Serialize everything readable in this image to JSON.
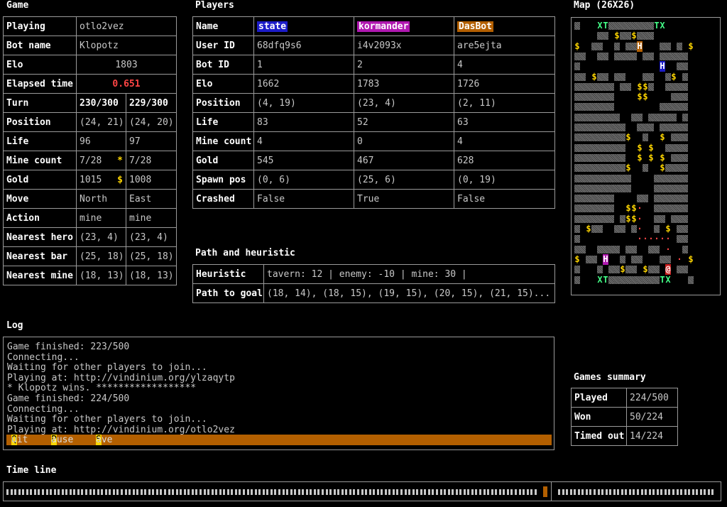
{
  "sections": {
    "game": "Game",
    "players": "Players",
    "map": "Map (26X26)",
    "path": "Path and heuristic",
    "log": "Log",
    "summary": "Games summary",
    "timeline": "Time line"
  },
  "game": {
    "playing_label": "Playing",
    "playing_value": "otlo2vez",
    "botname_label": "Bot name",
    "botname_value": "Klopotz",
    "elo_label": "Elo",
    "elo_value": "1803",
    "elapsed_label": "Elapsed time",
    "elapsed_value": "0.651",
    "turn_label": "Turn",
    "turn_a": "230/300",
    "turn_b": "229/300",
    "position_label": "Position",
    "position_a": "(24, 21)",
    "position_b": "(24, 20)",
    "life_label": "Life",
    "life_a": "96",
    "life_b": "97",
    "mine_label": "Mine count",
    "mine_a": "7/28",
    "mine_star": "*",
    "mine_b": "7/28",
    "gold_label": "Gold",
    "gold_a": "1015",
    "gold_sym": "$",
    "gold_b": "1008",
    "move_label": "Move",
    "move_a": "North",
    "move_b": "East",
    "action_label": "Action",
    "action_a": "mine",
    "action_b": "mine",
    "hero_label": "Nearest hero",
    "hero_a": "(23, 4)",
    "hero_b": "(23, 4)",
    "bar_label": "Nearest bar",
    "bar_a": "(25, 18)",
    "bar_b": "(25, 18)",
    "nmine_label": "Nearest mine",
    "nmine_a": "(18, 13)",
    "nmine_b": "(18, 13)"
  },
  "players": {
    "labels": {
      "name": "Name",
      "userid": "User ID",
      "botid": "Bot ID",
      "elo": "Elo",
      "position": "Position",
      "life": "Life",
      "minecount": "Mine count",
      "gold": "Gold",
      "spawn": "Spawn pos",
      "crashed": "Crashed"
    },
    "list": [
      {
        "name": "state",
        "color": "#1c1cc8",
        "userid": "68dfq9s6",
        "botid": "1",
        "elo": "1662",
        "position": "(4, 19)",
        "life": "83",
        "minecount": "4",
        "gold": "545",
        "spawn": "(0, 6)",
        "crashed": "False"
      },
      {
        "name": "kormander",
        "color": "#b018b0",
        "userid": "i4v2093x",
        "botid": "2",
        "elo": "1783",
        "position": "(23, 4)",
        "life": "52",
        "minecount": "0",
        "gold": "467",
        "spawn": "(25, 6)",
        "crashed": "True"
      },
      {
        "name": "DasBot",
        "color": "#b35f00",
        "userid": "are5ejta",
        "botid": "4",
        "elo": "1726",
        "position": "(2, 11)",
        "life": "63",
        "minecount": "4",
        "gold": "628",
        "spawn": "(0, 19)",
        "crashed": "False"
      }
    ]
  },
  "path": {
    "heuristic_label": "Heuristic",
    "heuristic_value": "tavern: 12 | enemy: -10 | mine: 30 |",
    "goal_label": "Path to goal",
    "goal_value": "(18, 14), (18, 15), (19, 15), (20, 15), (21, 15)..."
  },
  "log": {
    "lines": [
      "Game finished: 223/500",
      "Connecting...",
      "Waiting for other players to join...",
      "Playing at: http://vindinium.org/ylzaqytp",
      "* Klopotz wins. ******************",
      "Game finished: 224/500",
      "Connecting...",
      "Waiting for other players to join...",
      "Playing at: http://vindinium.org/otlo2vez"
    ],
    "menu": {
      "quit_key": "Q",
      "quit_rest": "uit",
      "pause_key": "P",
      "pause_rest": "ause",
      "save_key": "S",
      "save_rest": "ave"
    }
  },
  "summary": {
    "played_label": "Played",
    "played_value": "224/500",
    "won_label": "Won",
    "won_value": "50/224",
    "timeout_label": "Timed out",
    "timeout_value": "14/224"
  },
  "timeline": {
    "position_fraction": 0.76
  },
  "map": {
    "colors": {
      "tavern": "#44ff88",
      "gold": "#ffd700",
      "path": "#ff4545"
    }
  }
}
